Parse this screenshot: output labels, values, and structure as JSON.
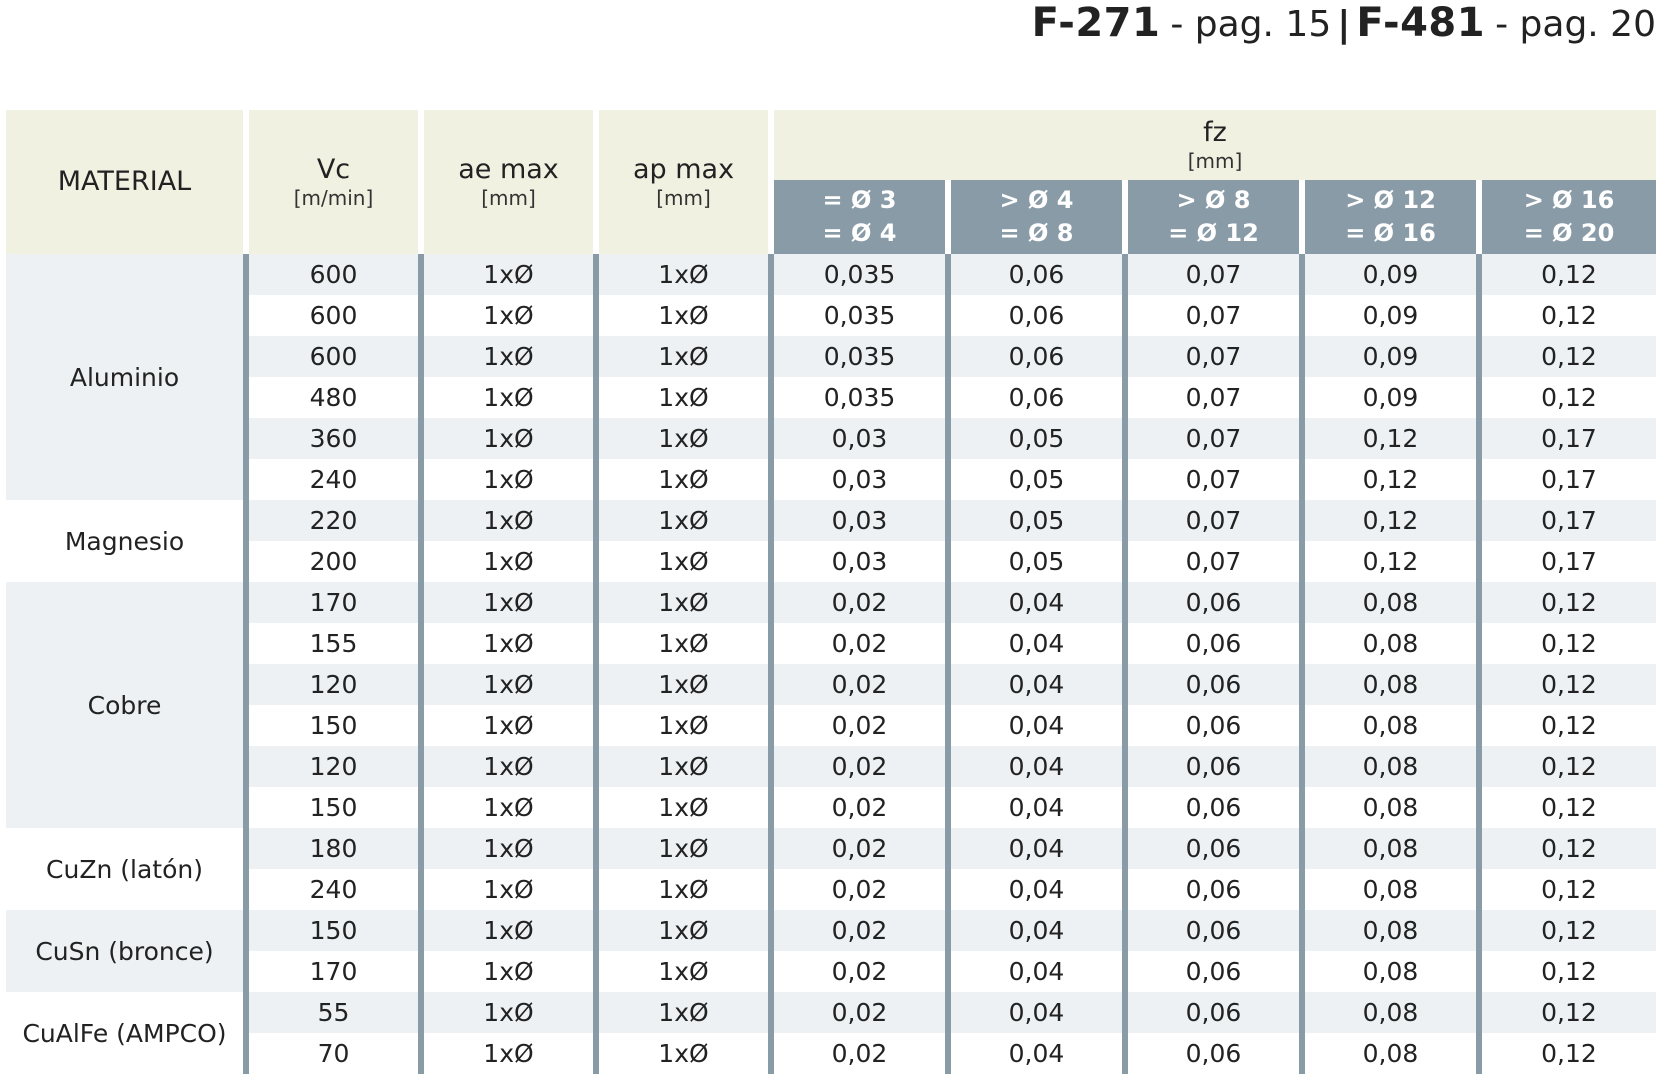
{
  "header": {
    "ref1_code": "F-271",
    "ref1_pag": "- pag. 15",
    "separator": "|",
    "ref2_code": "F-481",
    "ref2_pag": "- pag. 20"
  },
  "table": {
    "columns": {
      "material": "MATERIAL",
      "vc": "Vc",
      "vc_unit": "[m/min]",
      "ae": "ae max",
      "ae_unit": "[mm]",
      "ap": "ap max",
      "ap_unit": "[mm]",
      "fz": "fz",
      "fz_unit": "[mm]",
      "fz_ranges": [
        {
          "line1": "= Ø 3",
          "line2": "= Ø 4"
        },
        {
          "line1": "> Ø 4",
          "line2": "= Ø 8"
        },
        {
          "line1": "> Ø 8",
          "line2": "= Ø 12"
        },
        {
          "line1": "> Ø 12",
          "line2": "= Ø 16"
        },
        {
          "line1": "> Ø 16",
          "line2": "= Ø 20"
        }
      ]
    },
    "groups": [
      {
        "material": "Aluminio",
        "rows": [
          {
            "vc": "600",
            "ae": "1xØ",
            "ap": "1xØ",
            "fz": [
              "0,035",
              "0,06",
              "0,07",
              "0,09",
              "0,12"
            ]
          },
          {
            "vc": "600",
            "ae": "1xØ",
            "ap": "1xØ",
            "fz": [
              "0,035",
              "0,06",
              "0,07",
              "0,09",
              "0,12"
            ]
          },
          {
            "vc": "600",
            "ae": "1xØ",
            "ap": "1xØ",
            "fz": [
              "0,035",
              "0,06",
              "0,07",
              "0,09",
              "0,12"
            ]
          },
          {
            "vc": "480",
            "ae": "1xØ",
            "ap": "1xØ",
            "fz": [
              "0,035",
              "0,06",
              "0,07",
              "0,09",
              "0,12"
            ]
          },
          {
            "vc": "360",
            "ae": "1xØ",
            "ap": "1xØ",
            "fz": [
              "0,03",
              "0,05",
              "0,07",
              "0,12",
              "0,17"
            ]
          },
          {
            "vc": "240",
            "ae": "1xØ",
            "ap": "1xØ",
            "fz": [
              "0,03",
              "0,05",
              "0,07",
              "0,12",
              "0,17"
            ]
          }
        ]
      },
      {
        "material": "Magnesio",
        "rows": [
          {
            "vc": "220",
            "ae": "1xØ",
            "ap": "1xØ",
            "fz": [
              "0,03",
              "0,05",
              "0,07",
              "0,12",
              "0,17"
            ]
          },
          {
            "vc": "200",
            "ae": "1xØ",
            "ap": "1xØ",
            "fz": [
              "0,03",
              "0,05",
              "0,07",
              "0,12",
              "0,17"
            ]
          }
        ]
      },
      {
        "material": "Cobre",
        "rows": [
          {
            "vc": "170",
            "ae": "1xØ",
            "ap": "1xØ",
            "fz": [
              "0,02",
              "0,04",
              "0,06",
              "0,08",
              "0,12"
            ]
          },
          {
            "vc": "155",
            "ae": "1xØ",
            "ap": "1xØ",
            "fz": [
              "0,02",
              "0,04",
              "0,06",
              "0,08",
              "0,12"
            ]
          },
          {
            "vc": "120",
            "ae": "1xØ",
            "ap": "1xØ",
            "fz": [
              "0,02",
              "0,04",
              "0,06",
              "0,08",
              "0,12"
            ]
          },
          {
            "vc": "150",
            "ae": "1xØ",
            "ap": "1xØ",
            "fz": [
              "0,02",
              "0,04",
              "0,06",
              "0,08",
              "0,12"
            ]
          },
          {
            "vc": "120",
            "ae": "1xØ",
            "ap": "1xØ",
            "fz": [
              "0,02",
              "0,04",
              "0,06",
              "0,08",
              "0,12"
            ]
          },
          {
            "vc": "150",
            "ae": "1xØ",
            "ap": "1xØ",
            "fz": [
              "0,02",
              "0,04",
              "0,06",
              "0,08",
              "0,12"
            ]
          }
        ]
      },
      {
        "material": "CuZn (latón)",
        "rows": [
          {
            "vc": "180",
            "ae": "1xØ",
            "ap": "1xØ",
            "fz": [
              "0,02",
              "0,04",
              "0,06",
              "0,08",
              "0,12"
            ]
          },
          {
            "vc": "240",
            "ae": "1xØ",
            "ap": "1xØ",
            "fz": [
              "0,02",
              "0,04",
              "0,06",
              "0,08",
              "0,12"
            ]
          }
        ]
      },
      {
        "material": "CuSn (bronce)",
        "rows": [
          {
            "vc": "150",
            "ae": "1xØ",
            "ap": "1xØ",
            "fz": [
              "0,02",
              "0,04",
              "0,06",
              "0,08",
              "0,12"
            ]
          },
          {
            "vc": "170",
            "ae": "1xØ",
            "ap": "1xØ",
            "fz": [
              "0,02",
              "0,04",
              "0,06",
              "0,08",
              "0,12"
            ]
          }
        ]
      },
      {
        "material": "CuAlFe (AMPCO)",
        "rows": [
          {
            "vc": "55",
            "ae": "1xØ",
            "ap": "1xØ",
            "fz": [
              "0,02",
              "0,04",
              "0,06",
              "0,08",
              "0,12"
            ]
          },
          {
            "vc": "70",
            "ae": "1xØ",
            "ap": "1xØ",
            "fz": [
              "0,02",
              "0,04",
              "0,06",
              "0,08",
              "0,12"
            ]
          }
        ]
      }
    ]
  },
  "colors": {
    "header_bg": "#f1f1e1",
    "subheader_bg": "#8a9ba8",
    "row_stripe": "#edf1f4",
    "divider": "#8a9ba8"
  }
}
